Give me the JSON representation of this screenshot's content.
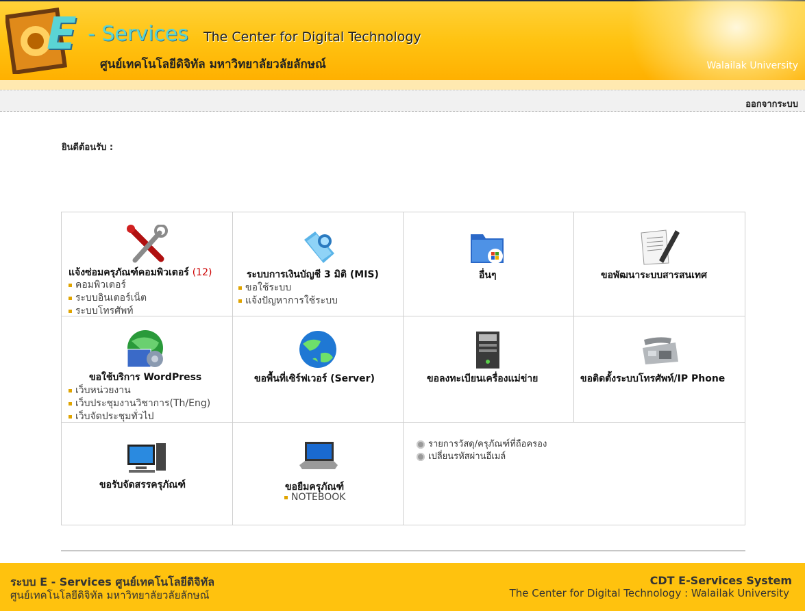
{
  "header": {
    "e_letter": "E",
    "e_services": "- Services",
    "center_name": "The Center for Digital Technology",
    "thai_center": "ศูนย์เทคโนโลยีดิจิทัล มหาวิทยาลัยวลัยลักษณ์",
    "university": "Walailak University"
  },
  "nav": {
    "logout": "ออกจากระบบ"
  },
  "welcome": "ยินดีต้อนรับ :",
  "services": {
    "repair": {
      "title": "แจ้งซ่อมครุภัณฑ์คอมพิวเตอร์",
      "count": "(12)",
      "items": [
        "คอมพิวเตอร์",
        "ระบบอินเตอร์เน็ต",
        "ระบบโทรศัพท์"
      ],
      "icon": "tools-icon"
    },
    "mis": {
      "title": "ระบบการเงินบัญชี 3 มิติ (MIS)",
      "items": [
        "ขอใช้ระบบ",
        "แจ้งปัญหาการใช้ระบบ"
      ],
      "icon": "folder-globe-icon"
    },
    "other": {
      "title": "อื่นๆ",
      "icon": "windows-folder-icon"
    },
    "develop": {
      "title": "ขอพัฒนาระบบสารสนเทศ",
      "icon": "document-pen-icon"
    },
    "wordpress": {
      "title": "ขอใช้บริการ WordPress",
      "items": [
        "เว็บหน่วยงาน",
        "เว็บประชุมงานวิชาการ(Th/Eng)",
        "เว็บจัดประชุมทั่วไป"
      ],
      "icon": "globe-web-icon"
    },
    "server": {
      "title": "ขอพื้นที่เซิร์ฟเวอร์ (Server)",
      "icon": "globe-network-icon"
    },
    "register": {
      "title": "ขอลงทะเบียนเครื่องแม่ข่าย",
      "icon": "server-tower-icon"
    },
    "phone": {
      "title": "ขอติดตั้งระบบโทรศัพท์/IP Phone",
      "icon": "ip-phone-icon"
    },
    "allocate": {
      "title": "ขอรับจัดสรรครุภัณฑ์",
      "icon": "desktop-computer-icon"
    },
    "borrow": {
      "title": "ขอยืมครุภัณฑ์",
      "items": [
        "NOTEBOOK"
      ],
      "icon": "laptop-icon"
    }
  },
  "links": [
    "รายการวัสดุ/ครุภัณฑ์ที่ถือครอง",
    "เปลี่ยนรหัสผ่านอีเมล์"
  ],
  "footer": {
    "left_title": "ระบบ E - Services ศูนย์เทคโนโลยีดิจิทัล",
    "left_sub": "ศูนย์เทคโนโลยีดิจิทัล มหาวิทยาลัยวลัยลักษณ์",
    "right_title": "CDT E-Services System",
    "right_sub": "The Center for Digital Technology : Walailak University"
  },
  "colors": {
    "header": "#ffc312",
    "footer": "#ffc20e",
    "bullet": "#e0a400",
    "count": "#cc0000"
  }
}
